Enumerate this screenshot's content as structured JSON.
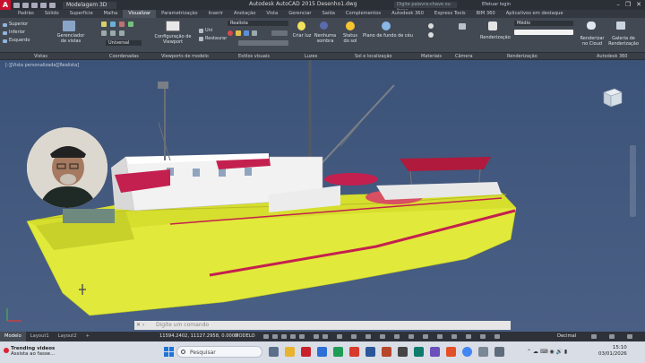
{
  "titlebar": {
    "workspace": "Modelagem 3D",
    "title": "Autodesk AutoCAD 2015   Desenho1.dwg",
    "search_placeholder": "Digite palavra-chave ou frase",
    "login": "Efetuar login",
    "controls": [
      "–",
      "❐",
      "✕"
    ]
  },
  "tabs": [
    {
      "label": "Padrão",
      "active": false
    },
    {
      "label": "Sólido",
      "active": false
    },
    {
      "label": "Superfície",
      "active": false
    },
    {
      "label": "Malha",
      "active": false
    },
    {
      "label": "Visualizar",
      "active": true
    },
    {
      "label": "Parametrização",
      "active": false
    },
    {
      "label": "Inserir",
      "active": false
    },
    {
      "label": "Anotação",
      "active": false
    },
    {
      "label": "Vista",
      "active": false
    },
    {
      "label": "Gerenciar",
      "active": false
    },
    {
      "label": "Saída",
      "active": false
    },
    {
      "label": "Complementos",
      "active": false
    },
    {
      "label": "Autodesk 360",
      "active": false
    },
    {
      "label": "Express Tools",
      "active": false
    },
    {
      "label": "BIM 360",
      "active": false
    },
    {
      "label": "Aplicativos em destaque",
      "active": false
    }
  ],
  "ribbon": {
    "views_list": [
      "Superior",
      "Inferior",
      "Esquerdo"
    ],
    "view_manager": "Gerenciador de vistas",
    "viewport_config": "Configuração de Viewport",
    "uni_label": "Uni",
    "restore_label": "Restaurar",
    "visual_style": "Realista",
    "universal": "Universal",
    "create_light": "Criar luz",
    "no_shadow": "Nenhuma sombra",
    "sun_status": "Status do sol",
    "sky_bg": "Plano de fundo de céu",
    "render_quality": "Médio",
    "render_label": "Renderização",
    "render_cloud": "Renderizar no Cloud",
    "render_gallery": "Galeria de Renderização"
  },
  "panels": [
    "Vistas",
    "Coordenadas",
    "Viewports de modelo",
    "Estilos visuais",
    "Luzes",
    "Sol e localização",
    "Materiais",
    "Câmera",
    "Renderização",
    "Autodesk 360"
  ],
  "viewport": {
    "label": "[-][Vista personalizada][Realista]",
    "command_placeholder": "Digite um comando"
  },
  "status": {
    "layout_tabs": [
      {
        "label": "Modelo",
        "active": true
      },
      {
        "label": "Layout1",
        "active": false
      },
      {
        "label": "Layout2",
        "active": false
      },
      {
        "label": "+",
        "active": false
      }
    ],
    "coords": "11594.2402, 11127.2958, 0.0000",
    "model": "MODELO",
    "units": "Decimal"
  },
  "taskbar": {
    "trending_title": "Trending videos",
    "trending_sub": "Assista ao fasse...",
    "search_label": "Pesquisar",
    "time": "15:10",
    "date": "03/01/2026"
  },
  "colors": {
    "hull": "#e1ea3a",
    "deck": "#ffffff",
    "accent": "#c4204f",
    "background": "#4a5f84"
  }
}
